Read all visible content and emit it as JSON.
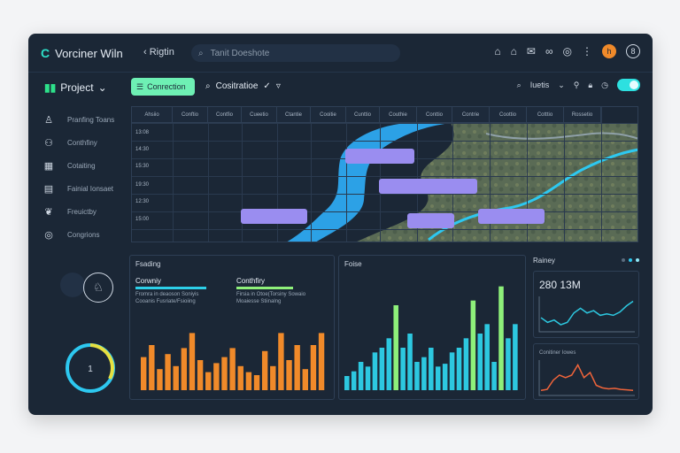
{
  "app": {
    "title": "Vorciner Wiln",
    "back_label": "Rigtin",
    "search_placeholder": "Tanit Doeshote",
    "avatar_initial": "h",
    "ring_label": "8"
  },
  "project": {
    "label": "Project"
  },
  "sidebar": {
    "items": [
      {
        "label": "Pranfing Toans",
        "icon": "person-icon"
      },
      {
        "label": "Conthfiny",
        "icon": "people-icon"
      },
      {
        "label": "Cotaiting",
        "icon": "calendar-icon"
      },
      {
        "label": "Fainial Ionsaet",
        "icon": "document-icon"
      },
      {
        "label": "Freuictby",
        "icon": "leaf-icon"
      },
      {
        "label": "Congrions",
        "icon": "target-icon"
      }
    ]
  },
  "toolbar": {
    "primary_label": "Conrection",
    "secondary_label": "Cositratioe",
    "right_label": "Iuetis"
  },
  "grid": {
    "columns": [
      "Ahsiio",
      "Conftio",
      "Contfio",
      "Cueetio",
      "Ctantie",
      "Cooitie",
      "Cunttio",
      "Couthie",
      "Conttio",
      "Contrie",
      "Coottio",
      "Cotttio",
      "Rossetio"
    ],
    "rows": [
      "13:08",
      "14:30",
      "15:30",
      "19:30",
      "12:30",
      "15:00"
    ]
  },
  "left_panel": {
    "title": "Fsading",
    "metric1": {
      "label": "Corwniy",
      "line1": "Fromra in deaoson Soniyis",
      "line2": "Cooanis Fusriate/Fsioiing",
      "color": "#2dcfe8"
    },
    "metric2": {
      "label": "Conthfiry",
      "line1": "Firsia in Otoe(Torsiny Sowaio",
      "line2": "Moaiesse Stiinalng",
      "color": "#8ef07a"
    },
    "gauge_value": "1"
  },
  "mid_panel": {
    "title": "Foise"
  },
  "right_panel": {
    "title": "Rainey",
    "value": "280 13M",
    "sub_title": "Conitiner Iowes"
  },
  "chart_data": [
    {
      "type": "bar",
      "title": "Fsading",
      "values": [
        5.5,
        7.5,
        3.5,
        6.0,
        4.0,
        7.0,
        9.5,
        5.0,
        3.0,
        4.5,
        5.5,
        7.0,
        4.0,
        3.0,
        2.5,
        6.5,
        4.0,
        9.5,
        5.0,
        7.5,
        3.5,
        7.5,
        9.5
      ],
      "color": "#f08a2a",
      "ylim": [
        0,
        10
      ]
    },
    {
      "type": "bar",
      "title": "Foise",
      "values": [
        1.5,
        2.0,
        3.0,
        2.5,
        4.0,
        4.5,
        5.5,
        9.0,
        4.5,
        6.0,
        3.0,
        3.5,
        4.5,
        2.5,
        2.8,
        4.0,
        4.5,
        5.5,
        9.5,
        6.0,
        7.0,
        3.0,
        11.0,
        5.5,
        7.0
      ],
      "highlight_indices": [
        7,
        18,
        22
      ],
      "color": "#2dc8e0",
      "highlight_color": "#8ef07a",
      "ylim": [
        0,
        12
      ]
    },
    {
      "type": "line",
      "title": "280 13M",
      "values": [
        3,
        2,
        2.5,
        1.5,
        2,
        4,
        5,
        4,
        4.5,
        3.5,
        3.8,
        3.5,
        4.2,
        5.5,
        6.5
      ],
      "color": "#2dc8e0"
    },
    {
      "type": "line",
      "title": "Conitiner Iowes",
      "values": [
        1,
        1.2,
        3,
        4,
        3.5,
        4,
        6,
        3.5,
        4.5,
        2,
        1.5,
        1.3,
        1.4,
        1.2,
        1.1,
        1
      ],
      "color": "#f0643a"
    }
  ],
  "colors": {
    "accent": "#2de0c8",
    "gantt": "#9a8df0",
    "water": "#2da8f0"
  }
}
